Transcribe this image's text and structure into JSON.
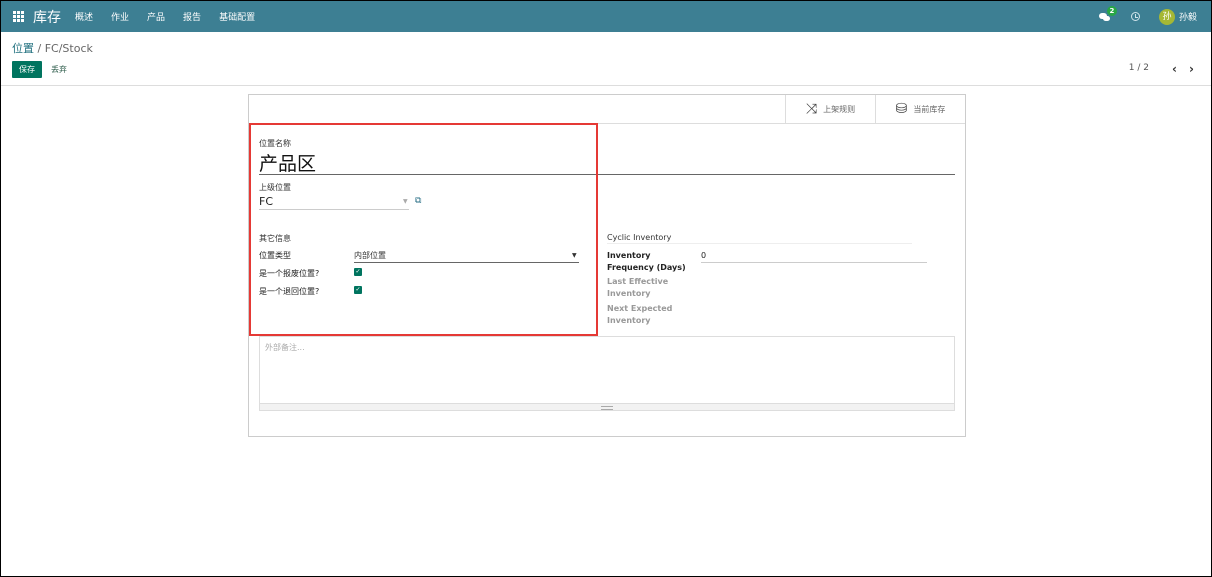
{
  "nav": {
    "brand": "库存",
    "menu": [
      "概述",
      "作业",
      "产品",
      "报告",
      "基础配置"
    ],
    "chat_count": "2",
    "avatar_initial": "孙",
    "username": "孙毅"
  },
  "control": {
    "breadcrumb_parent": "位置",
    "breadcrumb_sep": " / ",
    "breadcrumb_current": "FC/Stock",
    "save_label": "保存",
    "discard_label": "丢弃",
    "pager": "1 / 2"
  },
  "smart_buttons": {
    "putaway_label": "上架规则",
    "stock_label": "当前库存"
  },
  "form": {
    "name_label": "位置名称",
    "name_value": "产品区",
    "parent_label": "上级位置",
    "parent_value": "FC",
    "other_info_title": "其它信息",
    "location_type_label": "位置类型",
    "location_type_value": "内部位置",
    "scrap_label": "是一个报废位置?",
    "scrap_checked": true,
    "return_label": "是一个退回位置?",
    "return_checked": true,
    "cyclic_title": "Cyclic Inventory",
    "frequency_label": "Inventory Frequency (Days)",
    "frequency_value": "0",
    "last_effective_label": "Last Effective Inventory",
    "next_expected_label": "Next Expected Inventory",
    "notes_placeholder": "外部备注..."
  },
  "colors": {
    "navbar": "#3d7f93",
    "primary": "#00745f",
    "highlight": "#e53935"
  }
}
